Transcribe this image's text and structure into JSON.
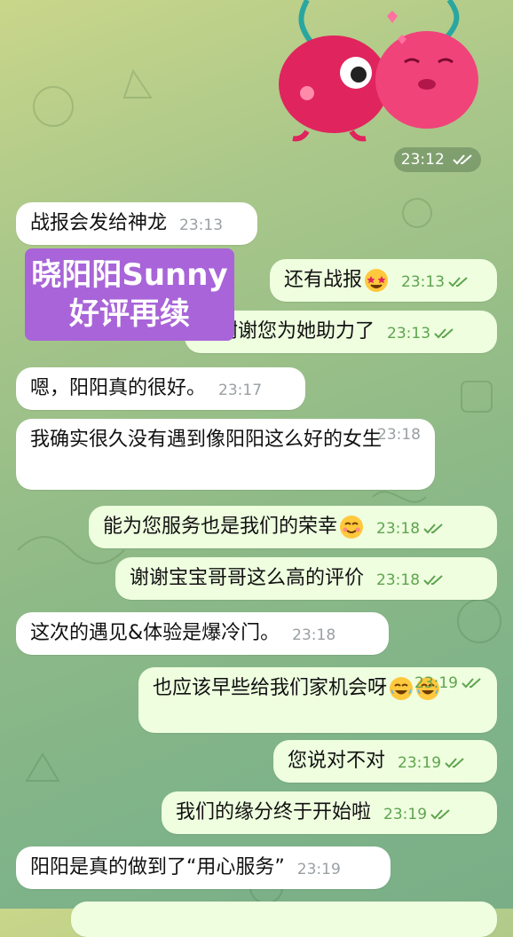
{
  "sticker": {
    "time": "23:12"
  },
  "overlay": {
    "line1": "晓阳阳Sunny",
    "line2": "好评再续"
  },
  "messages": [
    {
      "text": "战报会发给神龙",
      "time": "23:13",
      "dir": "in"
    },
    {
      "text": "还有战报",
      "time": "23:13",
      "dir": "out",
      "emoji": "star-struck-emoji"
    },
    {
      "text": "太谢谢您为她助力了",
      "time": "23:13",
      "dir": "out"
    },
    {
      "text": "嗯，阳阳真的很好。",
      "time": "23:17",
      "dir": "in"
    },
    {
      "text": "我确实很久没有遇到像阳阳这么好的女生",
      "time": "23:18",
      "dir": "in"
    },
    {
      "text": "能为您服务也是我们的荣幸",
      "time": "23:18",
      "dir": "out",
      "emoji": "smiling-emoji"
    },
    {
      "text": "谢谢宝宝哥哥这么高的评价",
      "time": "23:18",
      "dir": "out"
    },
    {
      "text": "这次的遇见&体验是爆冷门。",
      "time": "23:18",
      "dir": "in"
    },
    {
      "text": "也应该早些给我们家机会呀",
      "time": "23:19",
      "dir": "out",
      "emoji": "tears-of-joy-emoji"
    },
    {
      "text": "您说对不对",
      "time": "23:19",
      "dir": "out"
    },
    {
      "text": "我们的缘分终于开始啦",
      "time": "23:19",
      "dir": "out"
    },
    {
      "text": "阳阳是真的做到了“用心服务”",
      "time": "23:19",
      "dir": "in"
    }
  ],
  "colors": {
    "outgoing_bubble": "#eefedf",
    "incoming_bubble": "#ffffff",
    "read_check": "#5fa44e",
    "overlay_label": "#a864d8"
  }
}
